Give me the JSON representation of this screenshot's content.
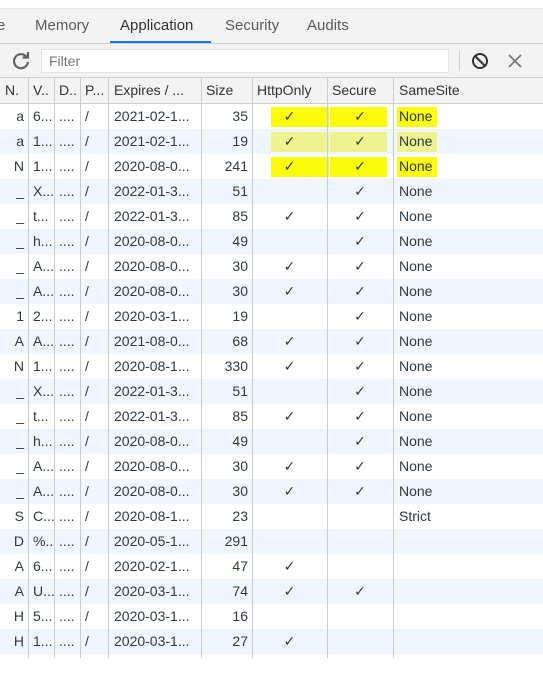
{
  "tabs": [
    {
      "label": "e",
      "active": false
    },
    {
      "label": "Memory",
      "active": false
    },
    {
      "label": "Application",
      "active": true
    },
    {
      "label": "Security",
      "active": false
    },
    {
      "label": "Audits",
      "active": false
    }
  ],
  "toolbar": {
    "filter_placeholder": "Filter",
    "refresh_icon": "refresh-icon",
    "clear_icon": "block-icon",
    "delete_icon": "close-icon"
  },
  "colors": {
    "accent": "#1a73e8",
    "highlighter": "#fbfb0c",
    "alt_row": "#f2f7fd"
  },
  "columns": [
    "N.",
    "V..",
    "D..",
    "P...",
    "Expires / ...",
    "Size",
    "HttpOnly",
    "Secure",
    "SameSite"
  ],
  "rows": [
    {
      "name": "a",
      "value": "6...",
      "domain": "....",
      "path": "/",
      "expires": "2021-02-1...",
      "size": "35",
      "httponly": "✓",
      "secure": "✓",
      "samesite": "None"
    },
    {
      "name": "a",
      "value": "1...",
      "domain": "....",
      "path": "/",
      "expires": "2021-02-1...",
      "size": "19",
      "httponly": "✓",
      "secure": "✓",
      "samesite": "None"
    },
    {
      "name": "N",
      "value": "1...",
      "domain": "....",
      "path": "/",
      "expires": "2020-08-0...",
      "size": "241",
      "httponly": "✓",
      "secure": "✓",
      "samesite": "None"
    },
    {
      "name": "_",
      "value": "X...",
      "domain": "....",
      "path": "/",
      "expires": "2022-01-3...",
      "size": "51",
      "httponly": "",
      "secure": "✓",
      "samesite": "None"
    },
    {
      "name": "_",
      "value": "t...",
      "domain": "....",
      "path": "/",
      "expires": "2022-01-3...",
      "size": "85",
      "httponly": "✓",
      "secure": "✓",
      "samesite": "None"
    },
    {
      "name": "_",
      "value": "h...",
      "domain": "....",
      "path": "/",
      "expires": "2020-08-0...",
      "size": "49",
      "httponly": "",
      "secure": "✓",
      "samesite": "None"
    },
    {
      "name": "_",
      "value": "A...",
      "domain": "....",
      "path": "/",
      "expires": "2020-08-0...",
      "size": "30",
      "httponly": "✓",
      "secure": "✓",
      "samesite": "None"
    },
    {
      "name": "_",
      "value": "A...",
      "domain": "....",
      "path": "/",
      "expires": "2020-08-0...",
      "size": "30",
      "httponly": "✓",
      "secure": "✓",
      "samesite": "None"
    },
    {
      "name": "1",
      "value": "2...",
      "domain": "....",
      "path": "/",
      "expires": "2020-03-1...",
      "size": "19",
      "httponly": "",
      "secure": "✓",
      "samesite": "None"
    },
    {
      "name": "A",
      "value": "A...",
      "domain": "....",
      "path": "/",
      "expires": "2021-08-0...",
      "size": "68",
      "httponly": "✓",
      "secure": "✓",
      "samesite": "None"
    },
    {
      "name": "N",
      "value": "1...",
      "domain": "....",
      "path": "/",
      "expires": "2020-08-1...",
      "size": "330",
      "httponly": "✓",
      "secure": "✓",
      "samesite": "None"
    },
    {
      "name": "_",
      "value": "X...",
      "domain": "....",
      "path": "/",
      "expires": "2022-01-3...",
      "size": "51",
      "httponly": "",
      "secure": "✓",
      "samesite": "None"
    },
    {
      "name": "_",
      "value": "t...",
      "domain": "....",
      "path": "/",
      "expires": "2022-01-3...",
      "size": "85",
      "httponly": "✓",
      "secure": "✓",
      "samesite": "None"
    },
    {
      "name": "_",
      "value": "h...",
      "domain": "....",
      "path": "/",
      "expires": "2020-08-0...",
      "size": "49",
      "httponly": "",
      "secure": "✓",
      "samesite": "None"
    },
    {
      "name": "_",
      "value": "A...",
      "domain": "....",
      "path": "/",
      "expires": "2020-08-0...",
      "size": "30",
      "httponly": "✓",
      "secure": "✓",
      "samesite": "None"
    },
    {
      "name": "_",
      "value": "A...",
      "domain": "....",
      "path": "/",
      "expires": "2020-08-0...",
      "size": "30",
      "httponly": "✓",
      "secure": "✓",
      "samesite": "None"
    },
    {
      "name": "S",
      "value": "C...",
      "domain": "....",
      "path": "/",
      "expires": "2020-08-1...",
      "size": "23",
      "httponly": "",
      "secure": "",
      "samesite": "Strict"
    },
    {
      "name": "D",
      "value": "%...",
      "domain": "....",
      "path": "/",
      "expires": "2020-05-1...",
      "size": "291",
      "httponly": "",
      "secure": "",
      "samesite": ""
    },
    {
      "name": "A",
      "value": "6...",
      "domain": "....",
      "path": "/",
      "expires": "2020-02-1...",
      "size": "47",
      "httponly": "✓",
      "secure": "",
      "samesite": ""
    },
    {
      "name": "A",
      "value": "U...",
      "domain": "....",
      "path": "/",
      "expires": "2020-03-1...",
      "size": "74",
      "httponly": "✓",
      "secure": "✓",
      "samesite": ""
    },
    {
      "name": "H",
      "value": "5...",
      "domain": "....",
      "path": "/",
      "expires": "2020-03-1...",
      "size": "16",
      "httponly": "",
      "secure": "",
      "samesite": ""
    },
    {
      "name": "H",
      "value": "1...",
      "domain": "....",
      "path": "/",
      "expires": "2020-03-1...",
      "size": "27",
      "httponly": "✓",
      "secure": "",
      "samesite": ""
    }
  ]
}
